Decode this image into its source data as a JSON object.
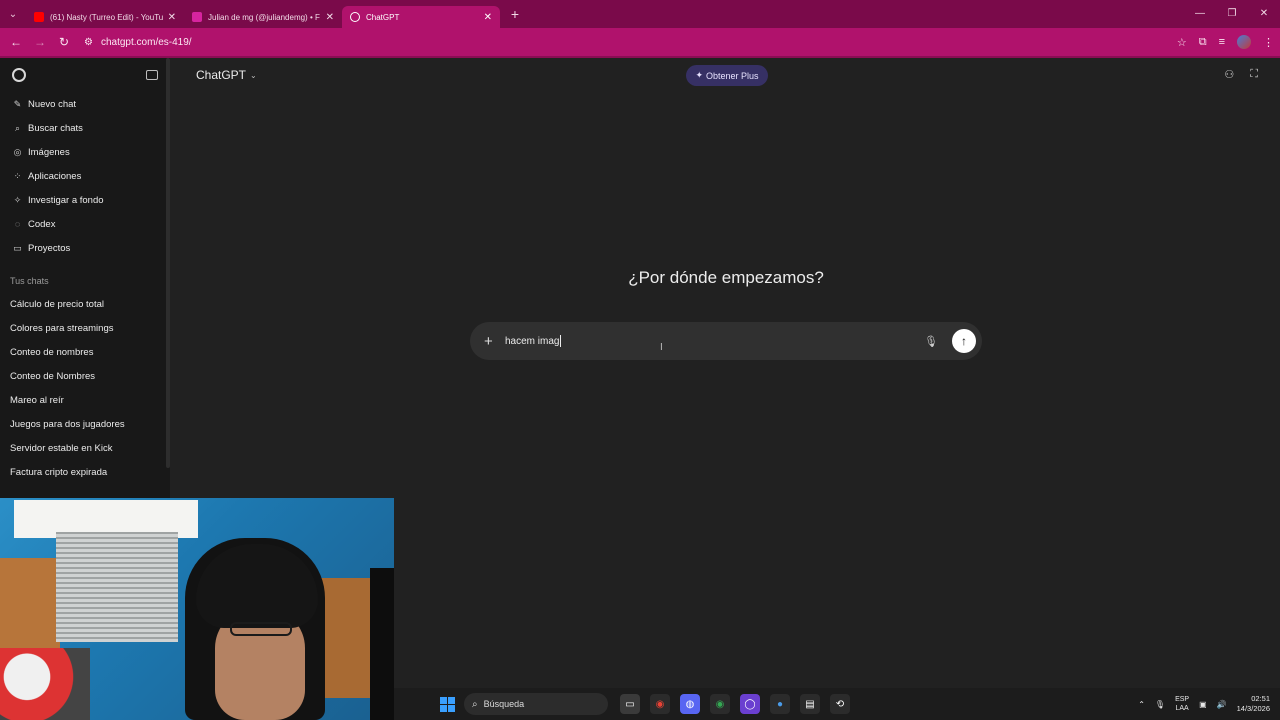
{
  "browser": {
    "tabs": [
      {
        "label": "(61) Nasty (Turreo Edit) - YouTu",
        "color": "#ff0000"
      },
      {
        "label": "Julian de mg (@juliandemg) • F",
        "color": "#d6249f"
      },
      {
        "label": "ChatGPT",
        "color": "#ffffff"
      }
    ],
    "new_tab": "+",
    "url": "chatgpt.com/es-419/"
  },
  "app": {
    "title": "ChatGPT",
    "upgrade_label": "Obtener Plus",
    "hero": "¿Por dónde empezamos?"
  },
  "sidebar": {
    "items": [
      {
        "label": "Nuevo chat",
        "icon": "compose-icon"
      },
      {
        "label": "Buscar chats",
        "icon": "search-icon"
      },
      {
        "label": "Imágenes",
        "icon": "images-icon"
      },
      {
        "label": "Aplicaciones",
        "icon": "apps-icon"
      },
      {
        "label": "Investigar a fondo",
        "icon": "research-icon"
      },
      {
        "label": "Codex",
        "icon": "codex-icon"
      },
      {
        "label": "Proyectos",
        "icon": "folder-icon"
      }
    ],
    "section_label": "Tus chats",
    "chats": [
      "Cálculo de precio total",
      "Colores para streamings",
      "Conteo de nombres",
      "Conteo de Nombres",
      "Mareo al reír",
      "Juegos para dos jugadores",
      "Servidor estable en Kick",
      "Factura cripto expirada"
    ]
  },
  "composer": {
    "value": "hacem imag"
  },
  "taskbar": {
    "search_label": "Búsqueda",
    "lang_top": "ESP",
    "lang_bottom": "LAA",
    "time": "02:51",
    "date": "14/3/2026"
  }
}
